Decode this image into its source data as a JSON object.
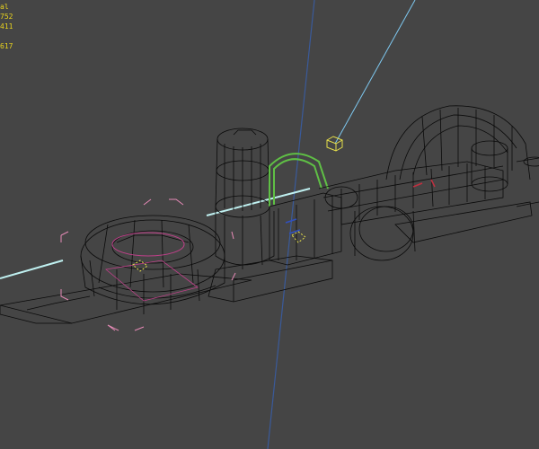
{
  "viewport": {
    "background": "#454545",
    "stats": {
      "line1": "al",
      "line2": "752",
      "line3": "411",
      "line4": "617"
    },
    "colors": {
      "wire": "#0a0a0a",
      "selection_bracket": "#e58ab6",
      "helper": "#e8e14a",
      "axis_blue": "#3a5a9a",
      "light_line": "#7ec8f0",
      "green_arch": "#5fbf45",
      "cyan_rail": "#bff0f0",
      "pink": "#c0408a"
    }
  }
}
